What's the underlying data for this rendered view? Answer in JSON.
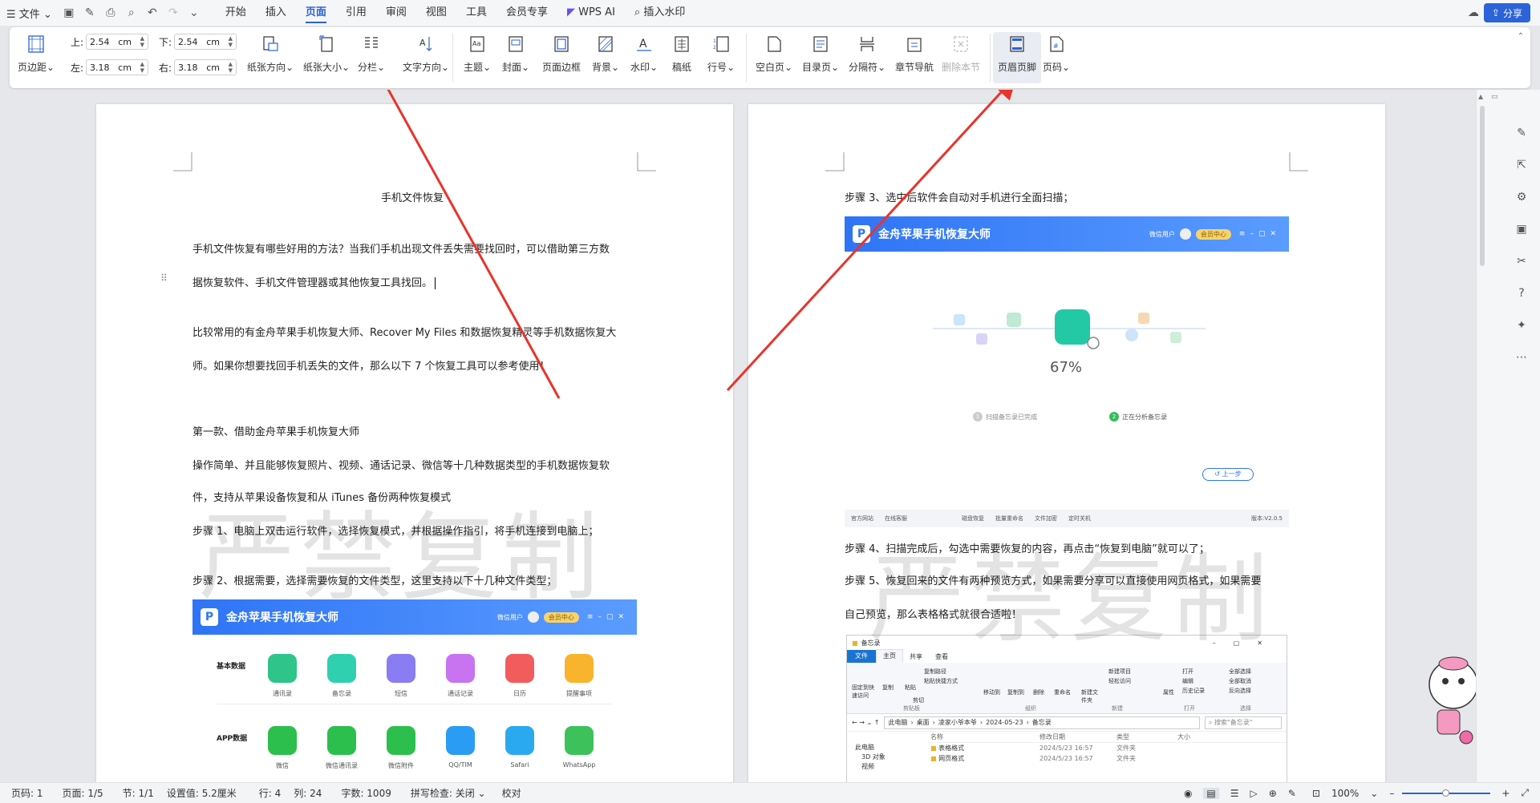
{
  "menu": {
    "file_label": "文件",
    "tabs": [
      "开始",
      "插入",
      "页面",
      "引用",
      "审阅",
      "视图",
      "工具",
      "会员专享"
    ],
    "active_tab": "页面",
    "wps_ai": "WPS AI",
    "insert_watermark": "插入水印",
    "share": "分享"
  },
  "ribbon": {
    "page_margin": "页边距",
    "margin_top_label": "上:",
    "margin_top": "2.54",
    "margin_bottom_label": "下:",
    "margin_bottom": "2.54",
    "margin_left_label": "左:",
    "margin_left": "3.18",
    "margin_right_label": "右:",
    "margin_right": "3.18",
    "unit": "cm",
    "orientation": "纸张方向",
    "paper_size": "纸张大小",
    "columns": "分栏",
    "text_direction": "文字方向",
    "theme": "主题",
    "cover": "封面",
    "page_border": "页面边框",
    "background": "背景",
    "watermark": "水印",
    "grid_paper": "稿纸",
    "line_number": "行号",
    "blank_page": "空白页",
    "toc_page": "目录页",
    "separator": "分隔符",
    "section_nav": "章节导航",
    "delete_section": "删除本节",
    "header_footer": "页眉页脚",
    "page_number": "页码"
  },
  "page1": {
    "title": "手机文件恢复",
    "p1_l1": "手机文件恢复有哪些好用的方法？当我们手机出现文件丢失需要找回时，可以借助第三方数",
    "p1_l2": "据恢复软件、手机文件管理器或其他恢复工具找回。",
    "p2_l1": "比较常用的有金舟苹果手机恢复大师、Recover My Files 和数据恢复精灵等手机数据恢复大",
    "p2_l2": "师。如果你想要找回手机丢失的文件，那么以下 7 个恢复工具可以参考使用！",
    "h1": "第一款、借助金舟苹果手机恢复大师",
    "p3_l1": "操作简单、并且能够恢复照片、视频、通话记录、微信等十几种数据类型的手机数据恢复软",
    "p3_l2": "件，支持从苹果设备恢复和从 iTunes 备份两种恢复模式",
    "step1": "步骤 1、电脑上双击运行软件，选择恢复模式，并根据操作指引，将手机连接到电脑上；",
    "step2": "步骤 2、根据需要，选择需要恢复的文件类型，这里支持以下十几种文件类型；",
    "app_title": "金舟苹果手机恢复大师",
    "app_user": "微信用户",
    "app_vip": "会员中心",
    "basic_label": "基本数据",
    "basic_items": [
      "通讯录",
      "备忘录",
      "短信",
      "通话记录",
      "日历",
      "提醒事项"
    ],
    "app_label": "APP数据",
    "app_items": [
      "微信",
      "微信通讯录",
      "微信附件",
      "QQ/TIM",
      "Safari",
      "WhatsApp"
    ]
  },
  "page2": {
    "step3": "步骤 3、选中后软件会自动对手机进行全面扫描；",
    "app_title": "金舟苹果手机恢复大师",
    "app_user": "微信用户",
    "app_vip": "会员中心",
    "progress": "67%",
    "scan_step1": "扫描备忘录已完成",
    "scan_step2": "正在分析备忘录",
    "back_button": "上一步",
    "footer_items": [
      "官方网站",
      "在线客服",
      "磁盘恢复",
      "批量重命名",
      "文件加密",
      "定时关机"
    ],
    "version": "版本:V2.0.5",
    "step4": "步骤 4、扫描完成后，勾选中需要恢复的内容，再点击“恢复到电脑”就可以了；",
    "step5_l1": "步骤 5、恢复回来的文件有两种预览方式，如果需要分享可以直接使用网页格式，如果需要",
    "step5_l2": "自己预览，那么表格格式就很合适啦！",
    "explorer": {
      "title": "备忘录",
      "tabs": [
        "文件",
        "主页",
        "共享",
        "查看"
      ],
      "ribbon_items": [
        "固定到快速访问",
        "复制",
        "粘贴",
        "剪切",
        "复制路径",
        "粘贴快捷方式",
        "移动到",
        "复制到",
        "删除",
        "重命名",
        "新建文件夹",
        "新建项目",
        "轻松访问",
        "属性",
        "打开",
        "编辑",
        "历史记录",
        "全部选择",
        "全部取消",
        "反向选择"
      ],
      "groups": [
        "剪贴板",
        "组织",
        "新建",
        "打开",
        "选择"
      ],
      "path": [
        "此电脑",
        "桌面",
        "凌家小爷本爷",
        "2024-05-23",
        "备忘录"
      ],
      "search_placeholder": "搜索\"备忘录\"",
      "nav_items": [
        "此电脑",
        "3D 对象",
        "视频"
      ],
      "columns": [
        "名称",
        "修改日期",
        "类型",
        "大小"
      ],
      "rows": [
        {
          "name": "表格格式",
          "date": "2024/5/23 16:57",
          "type": "文件夹"
        },
        {
          "name": "网页格式",
          "date": "2024/5/23 16:57",
          "type": "文件夹"
        }
      ]
    }
  },
  "watermark_text": "严禁复制",
  "status": {
    "page": "页码: 1",
    "pages": "页面: 1/5",
    "section": "节: 1/1",
    "setting": "设置值: 5.2厘米",
    "row": "行: 4",
    "col": "列: 24",
    "words": "字数: 1009",
    "spell": "拼写检查: 关闭",
    "proof": "校对",
    "zoom": "100%"
  },
  "colors": {
    "accent": "#2b63d9",
    "arrow": "#e8342b",
    "app_blue": "#2f74f6"
  }
}
